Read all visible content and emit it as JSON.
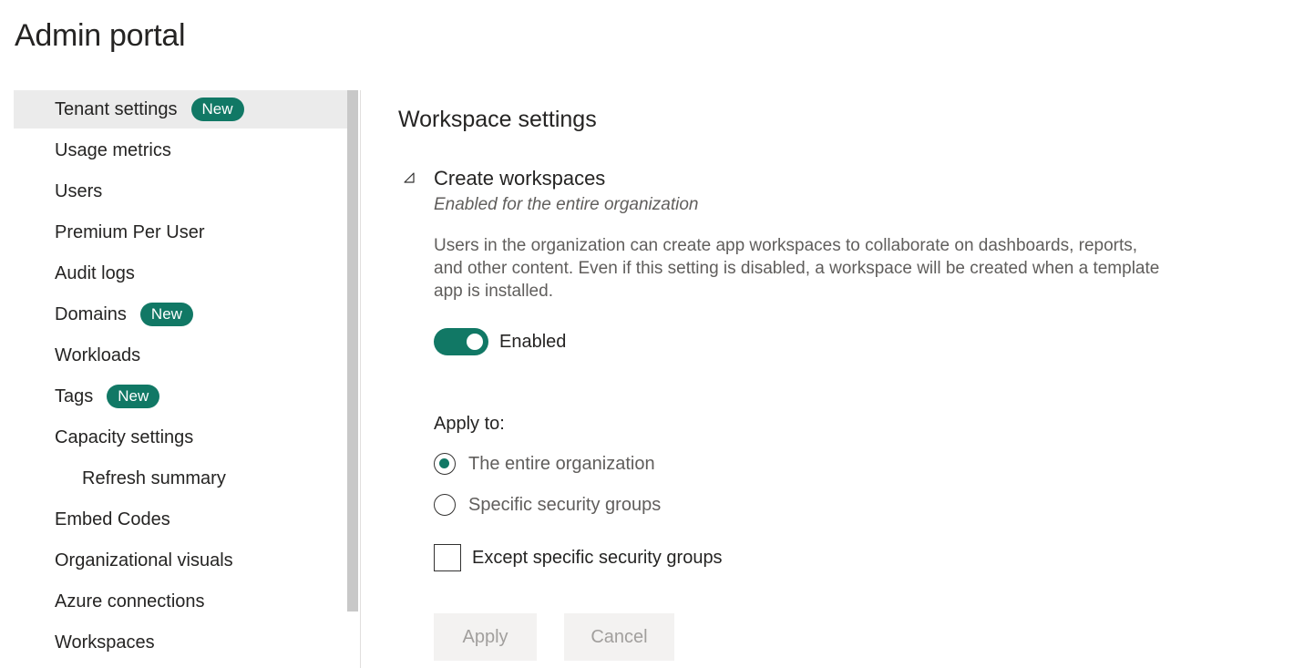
{
  "page": {
    "title": "Admin portal"
  },
  "sidebar": {
    "items": [
      {
        "label": "Tenant settings",
        "badge": "New"
      },
      {
        "label": "Usage metrics"
      },
      {
        "label": "Users"
      },
      {
        "label": "Premium Per User"
      },
      {
        "label": "Audit logs"
      },
      {
        "label": "Domains",
        "badge": "New"
      },
      {
        "label": "Workloads"
      },
      {
        "label": "Tags",
        "badge": "New"
      },
      {
        "label": "Capacity settings"
      },
      {
        "label": "Refresh summary"
      },
      {
        "label": "Embed Codes"
      },
      {
        "label": "Organizational visuals"
      },
      {
        "label": "Azure connections"
      },
      {
        "label": "Workspaces"
      }
    ]
  },
  "main": {
    "section_title": "Workspace settings",
    "setting": {
      "collapse_icon": "triangle-collapse-icon",
      "title": "Create workspaces",
      "subtitle": "Enabled for the entire organization",
      "description": "Users in the organization can create app workspaces to collaborate on dashboards, reports, and other content. Even if this setting is disabled, a workspace will be created when a template app is installed.",
      "toggle": {
        "on": true,
        "label": "Enabled"
      },
      "apply_to": {
        "label": "Apply to:",
        "options": [
          {
            "label": "The entire organization",
            "checked": true
          },
          {
            "label": "Specific security groups",
            "checked": false
          }
        ]
      },
      "except": {
        "label": "Except specific security groups",
        "checked": false
      }
    },
    "buttons": {
      "apply": "Apply",
      "cancel": "Cancel"
    }
  },
  "colors": {
    "accent": "#117865",
    "active_nav_bg": "#ebebeb",
    "disabled_button_bg": "#f3f2f1",
    "disabled_button_text": "#a19f9d"
  }
}
